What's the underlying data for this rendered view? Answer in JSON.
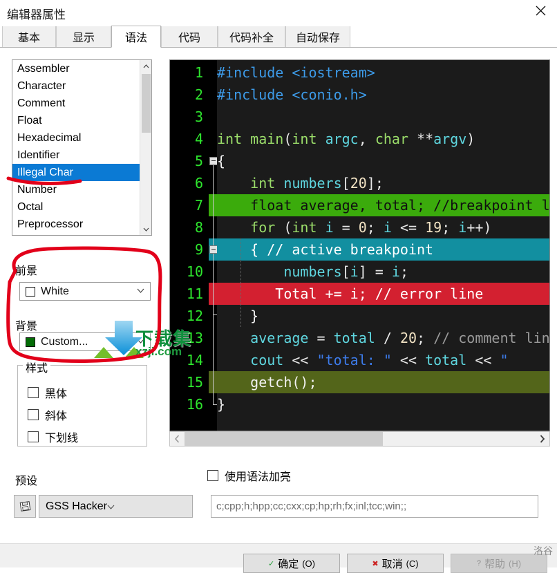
{
  "window": {
    "title": "编辑器属性",
    "close_icon": "close-icon"
  },
  "tabs": [
    {
      "label": "基本",
      "selected": false
    },
    {
      "label": "显示",
      "selected": false
    },
    {
      "label": "语法",
      "selected": true
    },
    {
      "label": "代码",
      "selected": false
    },
    {
      "label": "代码补全",
      "selected": false
    },
    {
      "label": "自动保存",
      "selected": false
    }
  ],
  "element_list": {
    "items": [
      {
        "label": "Assembler",
        "selected": false
      },
      {
        "label": "Character",
        "selected": false
      },
      {
        "label": "Comment",
        "selected": false
      },
      {
        "label": "Float",
        "selected": false
      },
      {
        "label": "Hexadecimal",
        "selected": false
      },
      {
        "label": "Identifier",
        "selected": false
      },
      {
        "label": "Illegal Char",
        "selected": true
      },
      {
        "label": "Number",
        "selected": false
      },
      {
        "label": "Octal",
        "selected": false
      },
      {
        "label": "Preprocessor",
        "selected": false
      }
    ],
    "scroll_up_icon": "chevron-up-icon",
    "scroll_down_icon": "chevron-down-icon"
  },
  "foreground": {
    "label": "前景",
    "value": "White",
    "swatch_color": "#ffffff",
    "arrow_icon": "chevron-down-icon"
  },
  "background": {
    "label": "背景",
    "value": "Custom...",
    "swatch_color": "#036b06",
    "arrow_icon": "chevron-down-icon"
  },
  "style_group": {
    "title": "样式",
    "options": [
      {
        "label": "黑体",
        "checked": false
      },
      {
        "label": "斜体",
        "checked": false
      },
      {
        "label": "下划线",
        "checked": false
      }
    ]
  },
  "preset": {
    "label": "预设",
    "value": "GSS Hacker",
    "icon": "save-disk-icon",
    "arrow_icon": "chevron-down-icon"
  },
  "syntax_highlight": {
    "label": "使用语法加亮",
    "checked": false
  },
  "extensions": {
    "value": "c;cpp;h;hpp;cc;cxx;cp;hp;rh;fx;inl;tcc;win;;"
  },
  "preview": {
    "background": "#1b1b1b",
    "gutter_background": "#000000",
    "line_number_color": "#2ee62e",
    "h_scroll": {
      "left_icon": "chevron-left-icon",
      "right_icon": "chevron-right-icon"
    },
    "lines": [
      {
        "num": "1",
        "bg": "",
        "tokens": [
          {
            "t": "#include ",
            "c": "#3d9be9"
          },
          {
            "t": "<iostream>",
            "c": "#3d9be9"
          }
        ]
      },
      {
        "num": "2",
        "bg": "",
        "tokens": [
          {
            "t": "#include ",
            "c": "#3d9be9"
          },
          {
            "t": "<conio.h>",
            "c": "#3d9be9"
          }
        ]
      },
      {
        "num": "3",
        "bg": "",
        "tokens": []
      },
      {
        "num": "4",
        "bg": "",
        "tokens": [
          {
            "t": "int",
            "c": "#9bdd6a"
          },
          {
            "t": " ",
            "c": "#e8e8e8"
          },
          {
            "t": "main",
            "c": "#9bdd6a"
          },
          {
            "t": "(",
            "c": "#e8e8e8"
          },
          {
            "t": "int",
            "c": "#9bdd6a"
          },
          {
            "t": " ",
            "c": "#e8e8e8"
          },
          {
            "t": "argc",
            "c": "#5fd7e0"
          },
          {
            "t": ", ",
            "c": "#e8e8e8"
          },
          {
            "t": "char",
            "c": "#9bdd6a"
          },
          {
            "t": " **",
            "c": "#e8e8e8"
          },
          {
            "t": "argv",
            "c": "#5fd7e0"
          },
          {
            "t": ")",
            "c": "#e8e8e8"
          }
        ]
      },
      {
        "num": "5",
        "bg": "",
        "fold": "start",
        "tokens": [
          {
            "t": "{",
            "c": "#f2f2f2"
          }
        ]
      },
      {
        "num": "6",
        "bg": "",
        "tokens": [
          {
            "t": "    ",
            "c": "#e8e8e8"
          },
          {
            "t": "int",
            "c": "#9bdd6a"
          },
          {
            "t": " ",
            "c": "#e8e8e8"
          },
          {
            "t": "numbers",
            "c": "#5fd7e0"
          },
          {
            "t": "[",
            "c": "#e8e8e8"
          },
          {
            "t": "20",
            "c": "#f2e3c4"
          },
          {
            "t": "];",
            "c": "#e8e8e8"
          }
        ]
      },
      {
        "num": "7",
        "bg": "#3bab0c",
        "tokens": [
          {
            "t": "    float average, total; //breakpoint line",
            "c": "#101010"
          }
        ]
      },
      {
        "num": "8",
        "bg": "",
        "tokens": [
          {
            "t": "    ",
            "c": "#e8e8e8"
          },
          {
            "t": "for",
            "c": "#9bdd6a"
          },
          {
            "t": " (",
            "c": "#e8e8e8"
          },
          {
            "t": "int",
            "c": "#9bdd6a"
          },
          {
            "t": " ",
            "c": "#e8e8e8"
          },
          {
            "t": "i",
            "c": "#5fd7e0"
          },
          {
            "t": " = ",
            "c": "#e8e8e8"
          },
          {
            "t": "0",
            "c": "#f2e3c4"
          },
          {
            "t": "; ",
            "c": "#e8e8e8"
          },
          {
            "t": "i",
            "c": "#5fd7e0"
          },
          {
            "t": " <= ",
            "c": "#e8e8e8"
          },
          {
            "t": "19",
            "c": "#f2e3c4"
          },
          {
            "t": "; ",
            "c": "#e8e8e8"
          },
          {
            "t": "i",
            "c": "#5fd7e0"
          },
          {
            "t": "++)",
            "c": "#e8e8e8"
          }
        ]
      },
      {
        "num": "9",
        "bg": "#128fa0",
        "fold": "mid",
        "tokens": [
          {
            "t": "    { // active breakpoint",
            "c": "#ffffff"
          }
        ]
      },
      {
        "num": "10",
        "bg": "",
        "tokens": [
          {
            "t": "        ",
            "c": "#e8e8e8"
          },
          {
            "t": "numbers",
            "c": "#5fd7e0"
          },
          {
            "t": "[",
            "c": "#e8e8e8"
          },
          {
            "t": "i",
            "c": "#5fd7e0"
          },
          {
            "t": "] = ",
            "c": "#e8e8e8"
          },
          {
            "t": "i",
            "c": "#5fd7e0"
          },
          {
            "t": ";",
            "c": "#e8e8e8"
          }
        ]
      },
      {
        "num": "11",
        "bg": "#d32030",
        "tokens": [
          {
            "t": "       Total += i; // error line",
            "c": "#ffffff"
          }
        ]
      },
      {
        "num": "12",
        "bg": "",
        "fold": "end-inner",
        "tokens": [
          {
            "t": "    }",
            "c": "#f2f2f2"
          }
        ]
      },
      {
        "num": "13",
        "bg": "",
        "tokens": [
          {
            "t": "    ",
            "c": "#e8e8e8"
          },
          {
            "t": "average",
            "c": "#5fd7e0"
          },
          {
            "t": " = ",
            "c": "#e8e8e8"
          },
          {
            "t": "total",
            "c": "#5fd7e0"
          },
          {
            "t": " / ",
            "c": "#e8e8e8"
          },
          {
            "t": "20",
            "c": "#f2e3c4"
          },
          {
            "t": "; ",
            "c": "#e8e8e8"
          },
          {
            "t": "// comment line",
            "c": "#9a9a9a"
          }
        ]
      },
      {
        "num": "14",
        "bg": "",
        "tokens": [
          {
            "t": "    ",
            "c": "#e8e8e8"
          },
          {
            "t": "cout",
            "c": "#5fd7e0"
          },
          {
            "t": " << ",
            "c": "#e8e8e8"
          },
          {
            "t": "\"total: \"",
            "c": "#3d7be9"
          },
          {
            "t": " << ",
            "c": "#e8e8e8"
          },
          {
            "t": "total",
            "c": "#5fd7e0"
          },
          {
            "t": " << ",
            "c": "#e8e8e8"
          },
          {
            "t": "\"",
            "c": "#3d7be9"
          }
        ]
      },
      {
        "num": "15",
        "bg": "#53651a",
        "tokens": [
          {
            "t": "    getch();",
            "c": "#f2f2f2"
          }
        ]
      },
      {
        "num": "16",
        "bg": "",
        "fold": "end",
        "tokens": [
          {
            "t": "}",
            "c": "#f2f2f2"
          }
        ]
      }
    ]
  },
  "footer": {
    "buttons": [
      {
        "label": "确定",
        "shortcut": "(O)",
        "icon": "check-icon",
        "icon_color": "#1d9c33",
        "disabled": false
      },
      {
        "label": "取消",
        "shortcut": "(C)",
        "icon": "cancel-icon",
        "icon_color": "#cc2222",
        "disabled": false
      },
      {
        "label": "帮助",
        "shortcut": "(H)",
        "icon": "help-icon",
        "icon_color": "#8c8c8c",
        "disabled": true
      }
    ],
    "corner_mark": "洛谷"
  },
  "watermark": {
    "text": "下载集",
    "sub": "xzji.com"
  }
}
